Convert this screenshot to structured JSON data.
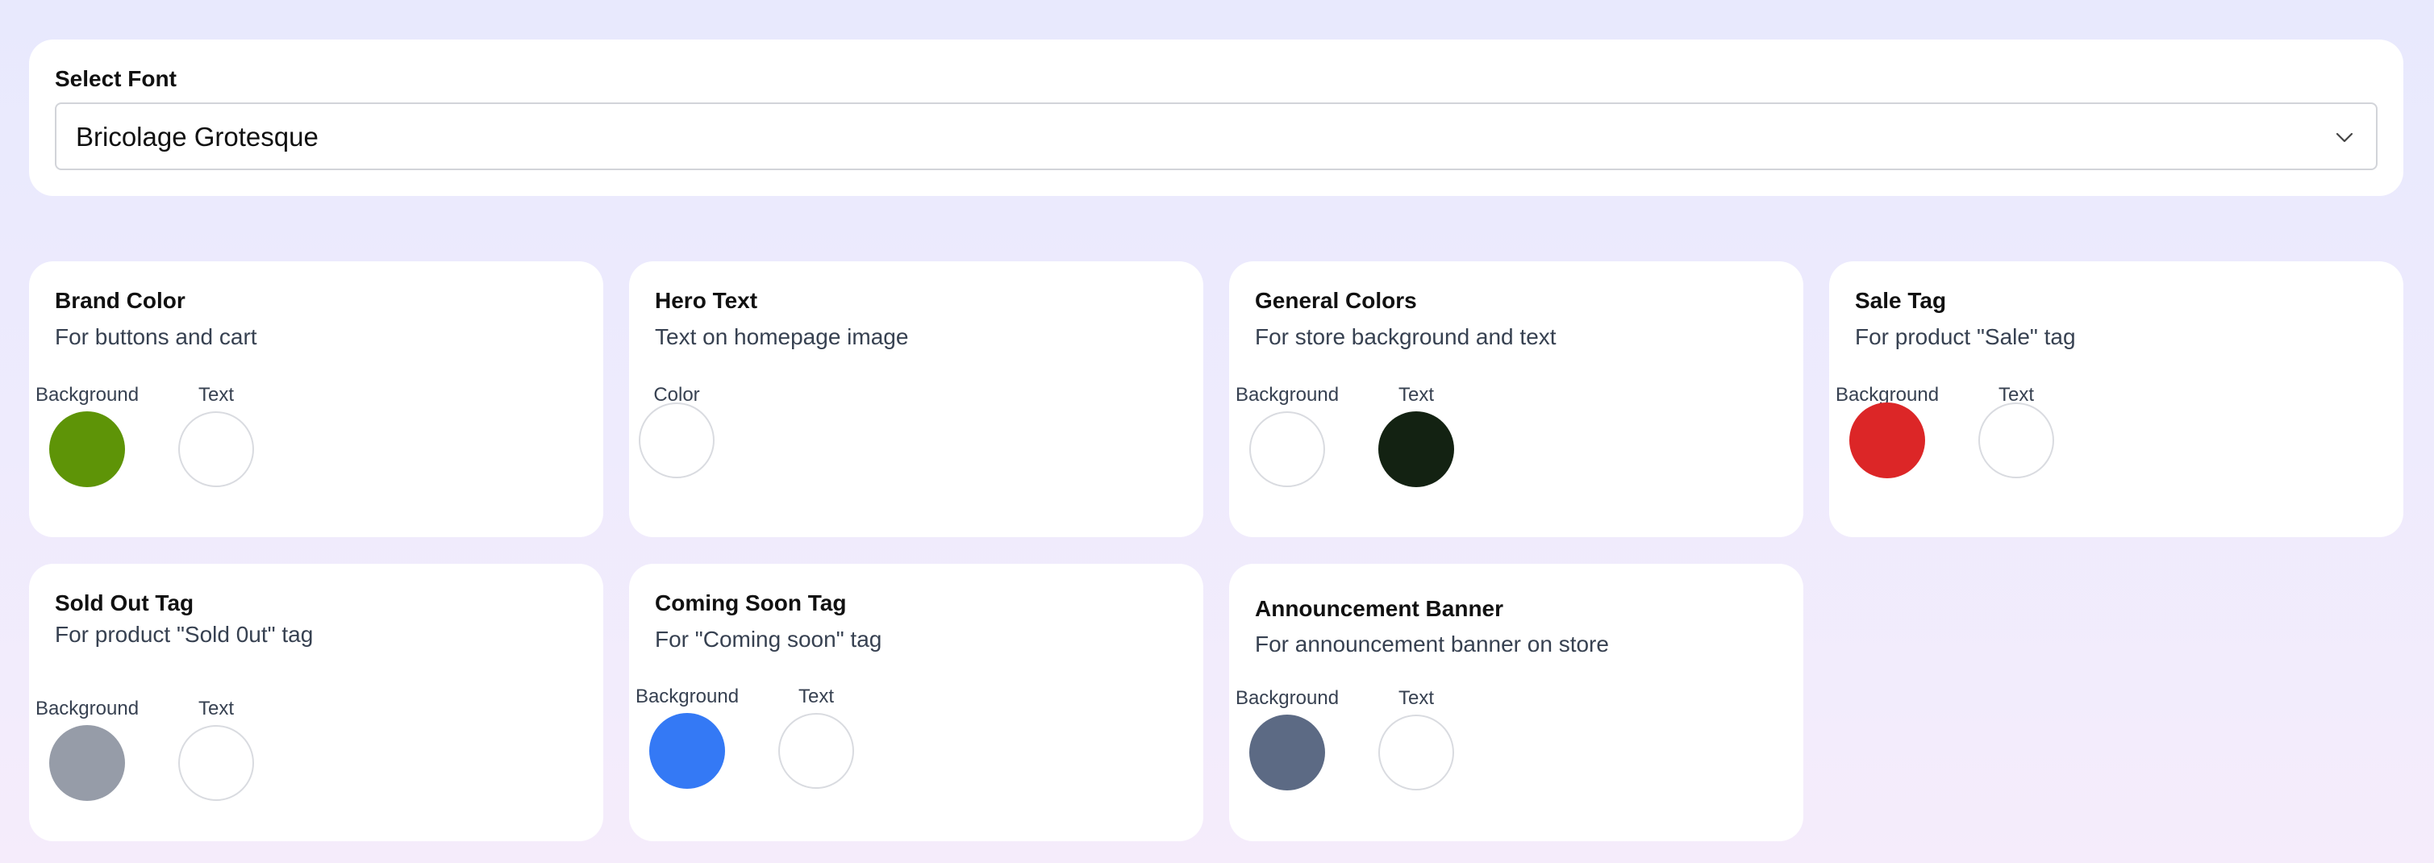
{
  "font_picker": {
    "label": "Select Font",
    "selected": "Bricolage Grotesque"
  },
  "cards": {
    "brand": {
      "title": "Brand Color",
      "desc": "For buttons and cart",
      "bg_label": "Background",
      "text_label": "Text",
      "bg_color": "#5e9407",
      "text_color": "#ffffff"
    },
    "hero": {
      "title": "Hero Text",
      "desc": "Text on homepage image",
      "color_label": "Color",
      "color": "#ffffff"
    },
    "general": {
      "title": "General Colors",
      "desc": "For store background and text",
      "bg_label": "Background",
      "text_label": "Text",
      "bg_color": "#ffffff",
      "text_color": "#132212"
    },
    "sale": {
      "title": "Sale Tag",
      "desc": "For product \"Sale\" tag",
      "bg_label": "Background",
      "text_label": "Text",
      "bg_color": "#dc2627",
      "text_color": "#ffffff"
    },
    "sold_out": {
      "title": "Sold Out Tag",
      "desc": "For product \"Sold 0ut\" tag",
      "bg_label": "Background",
      "text_label": "Text",
      "bg_color": "#969ca8",
      "text_color": "#ffffff"
    },
    "coming_soon": {
      "title": "Coming Soon Tag",
      "desc": "For \"Coming soon\" tag",
      "bg_label": "Background",
      "text_label": "Text",
      "bg_color": "#3479f5",
      "text_color": "#ffffff"
    },
    "announcement": {
      "title": "Announcement Banner",
      "desc": "For announcement banner on store",
      "bg_label": "Background",
      "text_label": "Text",
      "bg_color": "#5c6a84",
      "text_color": "#ffffff"
    }
  }
}
